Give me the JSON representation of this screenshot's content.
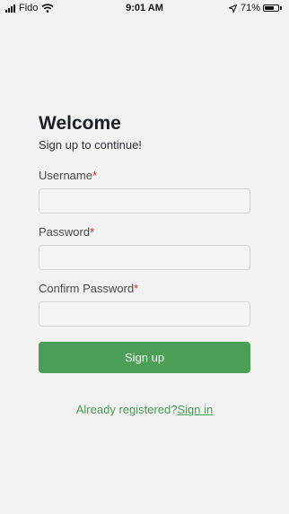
{
  "status_bar": {
    "carrier": "Fido",
    "time": "9:01 AM",
    "battery_percent_text": "71%",
    "battery_level": 0.71,
    "icons": [
      "signal-icon",
      "wifi-icon",
      "location-arrow-icon",
      "battery-icon"
    ]
  },
  "form": {
    "title": "Welcome",
    "subtitle": "Sign up to continue!",
    "required_marker": "*",
    "fields": [
      {
        "label": "Username",
        "value": "",
        "placeholder": ""
      },
      {
        "label": "Password",
        "value": "",
        "placeholder": ""
      },
      {
        "label": "Confirm Password",
        "value": "",
        "placeholder": ""
      }
    ],
    "submit_label": "Sign up"
  },
  "footer": {
    "prompt": "Already registered?",
    "link_label": "Sign in"
  },
  "colors": {
    "accent": "#4a9e55",
    "background": "#f2f2f2",
    "required": "#c0392b"
  }
}
